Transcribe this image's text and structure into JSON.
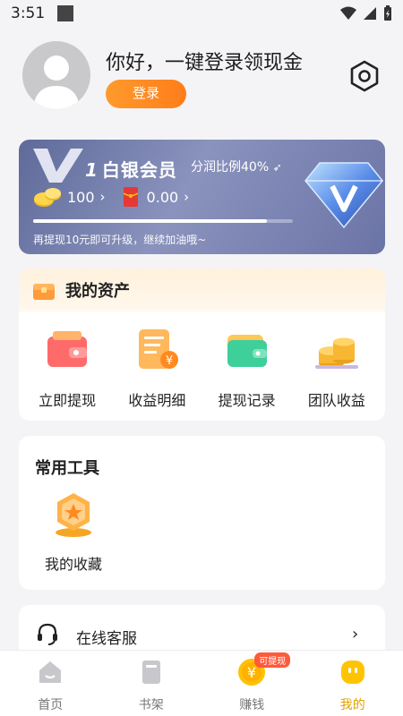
{
  "status_bar": {
    "time": "3:51"
  },
  "profile": {
    "greeting": "你好，一键登录领现金",
    "login_label": "登录"
  },
  "vip": {
    "level_label": "白银会员",
    "level_number": "1",
    "ratio_label": "分润比例40%",
    "coins": "100",
    "cash": "0.00",
    "progress": 0.9,
    "tip": "再提现10元即可升级，继续加油哦~"
  },
  "assets": {
    "title": "我的资产",
    "items": [
      {
        "label": "立即提现",
        "icon": "wallet-icon"
      },
      {
        "label": "收益明细",
        "icon": "receipt-icon"
      },
      {
        "label": "提现记录",
        "icon": "purse-icon"
      },
      {
        "label": "团队收益",
        "icon": "coin-stack-icon"
      }
    ]
  },
  "tools": {
    "title": "常用工具",
    "items": [
      {
        "label": "我的收藏",
        "icon": "star-badge-icon"
      }
    ]
  },
  "service": {
    "label": "在线客服"
  },
  "nav": {
    "items": [
      {
        "label": "首页"
      },
      {
        "label": "书架"
      },
      {
        "label": "赚钱",
        "badge": "可提现"
      },
      {
        "label": "我的"
      }
    ]
  },
  "colors": {
    "accent": "#ff8a1f",
    "active_tab": "#e2a300",
    "vip_card": "#6b74a6"
  }
}
